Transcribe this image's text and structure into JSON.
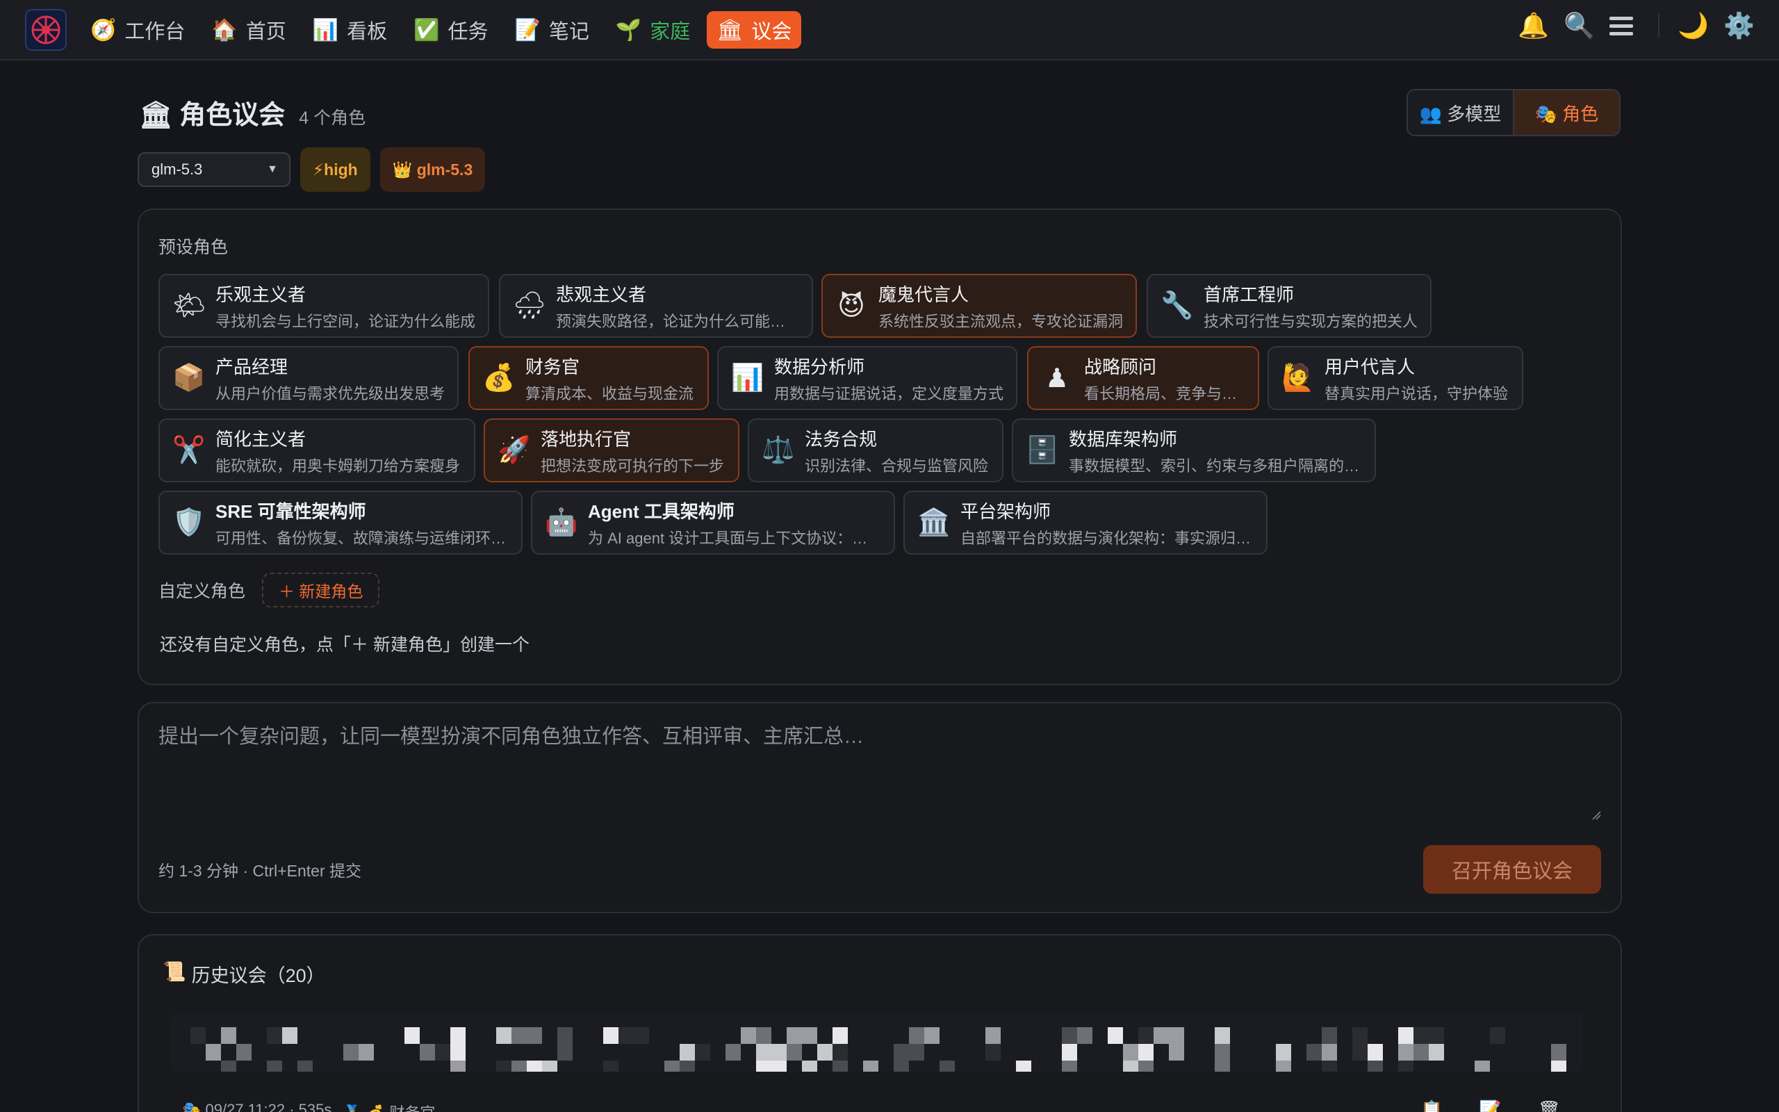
{
  "nav": {
    "items": [
      {
        "icon": "🧭",
        "label": "工作台"
      },
      {
        "icon": "🏠",
        "label": "首页"
      },
      {
        "icon": "📊",
        "label": "看板"
      },
      {
        "icon": "✅",
        "label": "任务"
      },
      {
        "icon": "📝",
        "label": "笔记"
      },
      {
        "icon": "🌱",
        "label": "家庭"
      },
      {
        "icon": "🏛",
        "label": "议会"
      }
    ],
    "right_icons": {
      "bell": "🔔",
      "search": "🔍",
      "theme": "🌙",
      "settings": "⚙️"
    }
  },
  "header": {
    "icon": "🏛",
    "title": "角色议会",
    "count": "4 个角色",
    "mode_multi": "👥 多模型",
    "mode_role": "🎭 角色"
  },
  "controls": {
    "model_select": "glm-5.3",
    "effort_badge": "⚡high",
    "chair_badge": "👑 glm-5.3"
  },
  "roles": {
    "preset_label": "预设角色",
    "cards": [
      {
        "emoji": "🌤",
        "name": "乐观主义者",
        "desc": "寻找机会与上行空间，论证为什么能成"
      },
      {
        "emoji": "🌧",
        "name": "悲观主义者",
        "desc": "预演失败路径，论证为什么可能失败"
      },
      {
        "emoji": "😈",
        "name": "魔鬼代言人",
        "desc": "系统性反驳主流观点，专攻论证漏洞"
      },
      {
        "emoji": "🔧",
        "name": "首席工程师",
        "desc": "技术可行性与实现方案的把关人"
      },
      {
        "emoji": "📦",
        "name": "产品经理",
        "desc": "从用户价值与需求优先级出发思考"
      },
      {
        "emoji": "💰",
        "name": "财务官",
        "desc": "算清成本、收益与现金流"
      },
      {
        "emoji": "📊",
        "name": "数据分析师",
        "desc": "用数据与证据说话，定义度量方式"
      },
      {
        "emoji": "♟",
        "name": "战略顾问",
        "desc": "看长期格局、竞争与博弈"
      },
      {
        "emoji": "🙋",
        "name": "用户代言人",
        "desc": "替真实用户说话，守护体验"
      },
      {
        "emoji": "✂️",
        "name": "简化主义者",
        "desc": "能砍就砍，用奥卡姆剃刀给方案瘦身"
      },
      {
        "emoji": "🚀",
        "name": "落地执行官",
        "desc": "把想法变成可执行的下一步"
      },
      {
        "emoji": "⚖️",
        "name": "法务合规",
        "desc": "识别法律、合规与监管风险"
      },
      {
        "emoji": "🗄️",
        "name": "数据库架构师",
        "desc": "事数据模型、索引、约束与多租户隔离的…"
      },
      {
        "emoji": "🛡️",
        "name": "SRE 可靠性架构师",
        "desc": "可用性、备份恢复、故障演练与运维闭环…"
      },
      {
        "emoji": "🤖",
        "name": "Agent 工具架构师",
        "desc": "为 AI agent 设计工具面与上下文协议：…"
      },
      {
        "emoji": "🏛️",
        "name": "平台架构师",
        "desc": "自部署平台的数据与演化架构：事实源归…"
      }
    ],
    "custom_label": "自定义角色",
    "new_role_button": "＋ 新建角色",
    "empty_hint": "还没有自定义角色，点「＋ 新建角色」创建一个"
  },
  "question": {
    "placeholder": "提出一个复杂问题，让同一模型扮演不同角色独立作答、互相评审、主席汇总…",
    "hint": "约 1-3 分钟 · Ctrl+Enter 提交",
    "submit_label": "召开角色议会"
  },
  "history": {
    "icon": "📜",
    "title": "历史议会（20）",
    "meta_time": "🎭 09/27 11:22 · 535s",
    "meta_chair": "🥇 💰 财务官",
    "actions": [
      "📋",
      "📝",
      "🗑"
    ]
  },
  "colors": {
    "accent": "#ee5a24",
    "background": "#14161b",
    "family_green": "#3fb35b"
  }
}
